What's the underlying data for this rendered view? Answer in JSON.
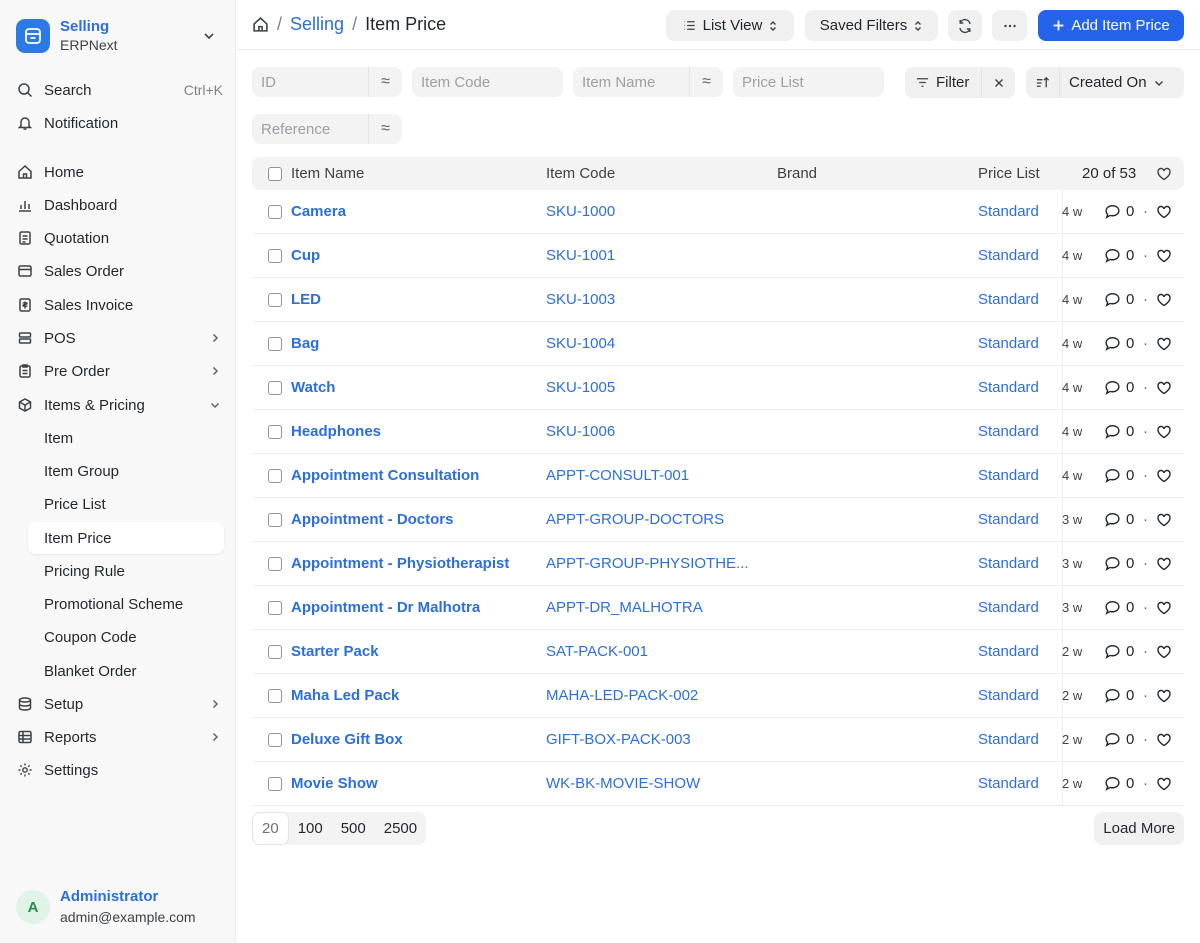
{
  "brand": {
    "title": "Selling",
    "subtitle": "ERPNext"
  },
  "search": {
    "label": "Search",
    "shortcut": "Ctrl+K"
  },
  "notification": {
    "label": "Notification"
  },
  "nav": {
    "home": "Home",
    "dashboard": "Dashboard",
    "quotation": "Quotation",
    "sales_order": "Sales Order",
    "sales_invoice": "Sales Invoice",
    "pos": "POS",
    "pre_order": "Pre Order",
    "items_pricing": "Items & Pricing",
    "sub": [
      "Item",
      "Item Group",
      "Price List",
      "Item Price",
      "Pricing Rule",
      "Promotional Scheme",
      "Coupon Code",
      "Blanket Order"
    ],
    "setup": "Setup",
    "reports": "Reports",
    "settings": "Settings"
  },
  "user": {
    "initial": "A",
    "name": "Administrator",
    "email": "admin@example.com"
  },
  "breadcrumb": {
    "parent": "Selling",
    "current": "Item Price"
  },
  "toolbar": {
    "list_view": "List View",
    "saved_filters": "Saved Filters",
    "add_button": "Add Item Price"
  },
  "filters": {
    "id": "ID",
    "item_code": "Item Code",
    "item_name": "Item Name",
    "price_list": "Price List",
    "reference": "Reference",
    "filter_label": "Filter",
    "sort_label": "Created On"
  },
  "table": {
    "headers": {
      "item_name": "Item Name",
      "item_code": "Item Code",
      "brand": "Brand",
      "price_list": "Price List",
      "count": "20 of 53"
    },
    "rows": [
      {
        "name": "Camera",
        "code": "SKU-1000",
        "price_list": "Standard",
        "ago": "4 w",
        "comments": "0"
      },
      {
        "name": "Cup",
        "code": "SKU-1001",
        "price_list": "Standard",
        "ago": "4 w",
        "comments": "0"
      },
      {
        "name": "LED",
        "code": "SKU-1003",
        "price_list": "Standard",
        "ago": "4 w",
        "comments": "0"
      },
      {
        "name": "Bag",
        "code": "SKU-1004",
        "price_list": "Standard",
        "ago": "4 w",
        "comments": "0"
      },
      {
        "name": "Watch",
        "code": "SKU-1005",
        "price_list": "Standard",
        "ago": "4 w",
        "comments": "0"
      },
      {
        "name": "Headphones",
        "code": "SKU-1006",
        "price_list": "Standard",
        "ago": "4 w",
        "comments": "0"
      },
      {
        "name": "Appointment Consultation",
        "code": "APPT-CONSULT-001",
        "price_list": "Standard",
        "ago": "4 w",
        "comments": "0"
      },
      {
        "name": "Appointment - Doctors",
        "code": "APPT-GROUP-DOCTORS",
        "price_list": "Standard",
        "ago": "3 w",
        "comments": "0"
      },
      {
        "name": "Appointment - Physiotherapist",
        "code": "APPT-GROUP-PHYSIOTHE...",
        "price_list": "Standard",
        "ago": "3 w",
        "comments": "0"
      },
      {
        "name": "Appointment - Dr Malhotra",
        "code": "APPT-DR_MALHOTRA",
        "price_list": "Standard",
        "ago": "3 w",
        "comments": "0"
      },
      {
        "name": "Starter Pack",
        "code": "SAT-PACK-001",
        "price_list": "Standard",
        "ago": "2 w",
        "comments": "0"
      },
      {
        "name": "Maha Led Pack",
        "code": "MAHA-LED-PACK-002",
        "price_list": "Standard",
        "ago": "2 w",
        "comments": "0"
      },
      {
        "name": "Deluxe Gift Box",
        "code": "GIFT-BOX-PACK-003",
        "price_list": "Standard",
        "ago": "2 w",
        "comments": "0"
      },
      {
        "name": "Movie Show",
        "code": "WK-BK-MOVIE-SHOW",
        "price_list": "Standard",
        "ago": "2 w",
        "comments": "0"
      }
    ]
  },
  "pager": {
    "sizes": [
      "20",
      "100",
      "500",
      "2500"
    ],
    "load_more": "Load More"
  },
  "colors": {
    "accent": "#2c6fd6",
    "primary_button": "#2563eb"
  }
}
